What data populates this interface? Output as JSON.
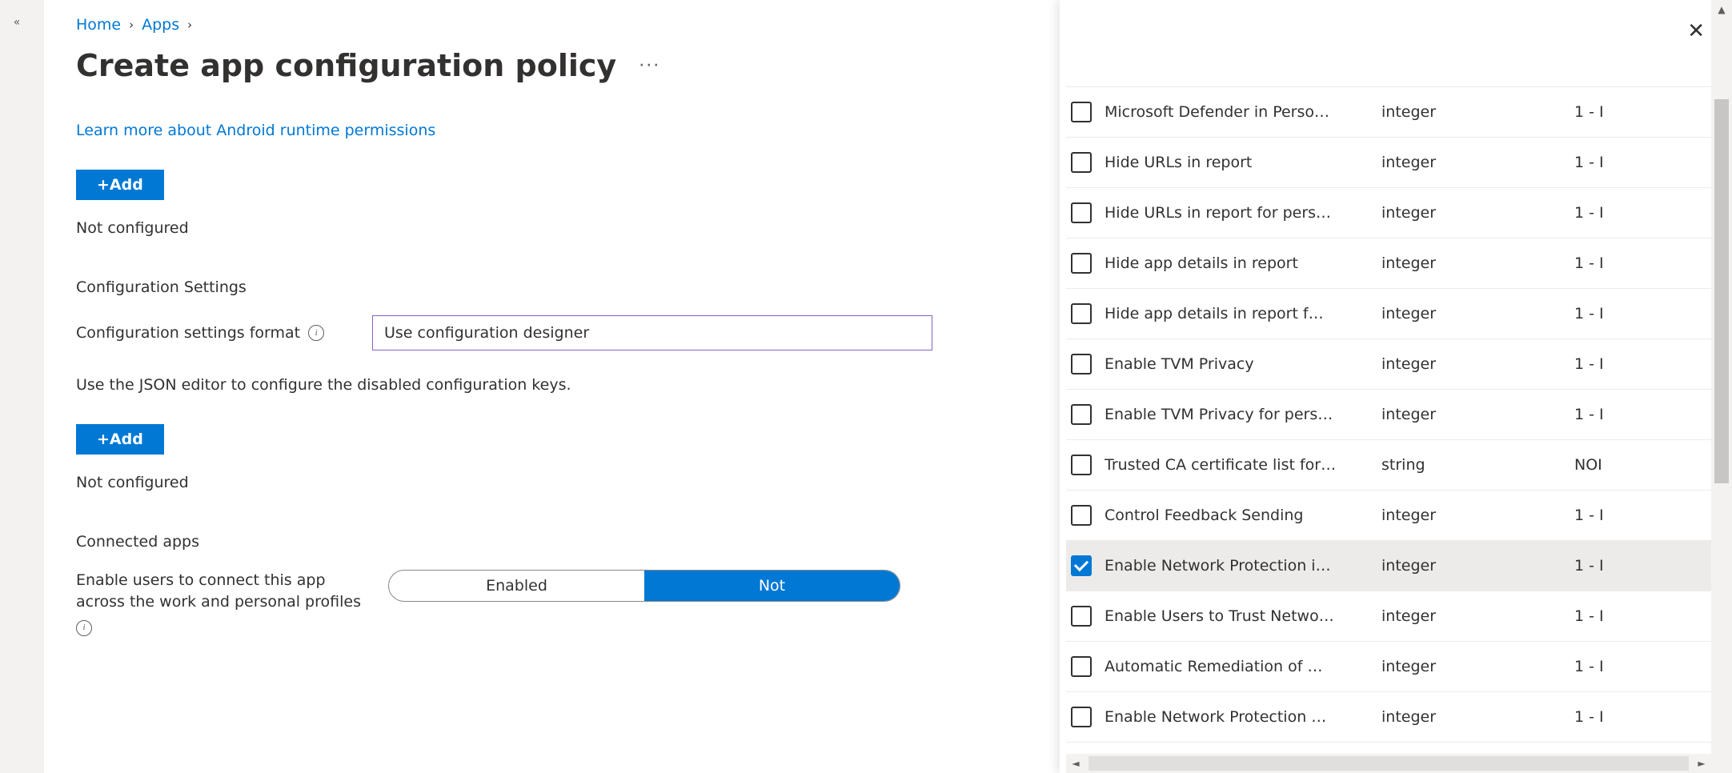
{
  "breadcrumb": {
    "home": "Home",
    "apps": "Apps"
  },
  "page": {
    "title": "Create app configuration policy"
  },
  "links": {
    "learnPerms": "Learn more about Android runtime permissions"
  },
  "buttons": {
    "add": "+Add"
  },
  "status": {
    "perm": "Not configured",
    "keys": "Not configured"
  },
  "sections": {
    "config": "Configuration Settings",
    "formatLabel": "Configuration settings format",
    "formatValue": "Use configuration designer",
    "jsonHelp": "Use the JSON editor to configure the disabled configuration keys.",
    "connected": "Connected apps",
    "connectedDesc": "Enable users to connect this app across the work and personal profiles"
  },
  "toggle": {
    "opt1": "Enabled",
    "opt2": "Not"
  },
  "panel": {
    "rows": [
      {
        "key": "Microsoft Defender in Perso…",
        "type": "integer",
        "val": "1 - I",
        "checked": false
      },
      {
        "key": "Hide URLs in report",
        "type": "integer",
        "val": "1 - I",
        "checked": false
      },
      {
        "key": "Hide URLs in report for pers…",
        "type": "integer",
        "val": "1 - I",
        "checked": false
      },
      {
        "key": "Hide app details in report",
        "type": "integer",
        "val": "1 - I",
        "checked": false
      },
      {
        "key": "Hide app details in report f…",
        "type": "integer",
        "val": "1 - I",
        "checked": false
      },
      {
        "key": "Enable TVM Privacy",
        "type": "integer",
        "val": "1 - I",
        "checked": false
      },
      {
        "key": "Enable TVM Privacy for pers…",
        "type": "integer",
        "val": "1 - I",
        "checked": false
      },
      {
        "key": "Trusted CA certificate list for…",
        "type": "string",
        "val": "NOI",
        "checked": false
      },
      {
        "key": "Control Feedback Sending",
        "type": "integer",
        "val": "1 - I",
        "checked": false
      },
      {
        "key": "Enable Network Protection i…",
        "type": "integer",
        "val": "1 - I",
        "checked": true
      },
      {
        "key": "Enable Users to Trust Netwo…",
        "type": "integer",
        "val": "1 - I",
        "checked": false
      },
      {
        "key": "Automatic Remediation of …",
        "type": "integer",
        "val": "1 - I",
        "checked": false
      },
      {
        "key": "Enable Network Protection …",
        "type": "integer",
        "val": "1 - I",
        "checked": false
      }
    ]
  }
}
